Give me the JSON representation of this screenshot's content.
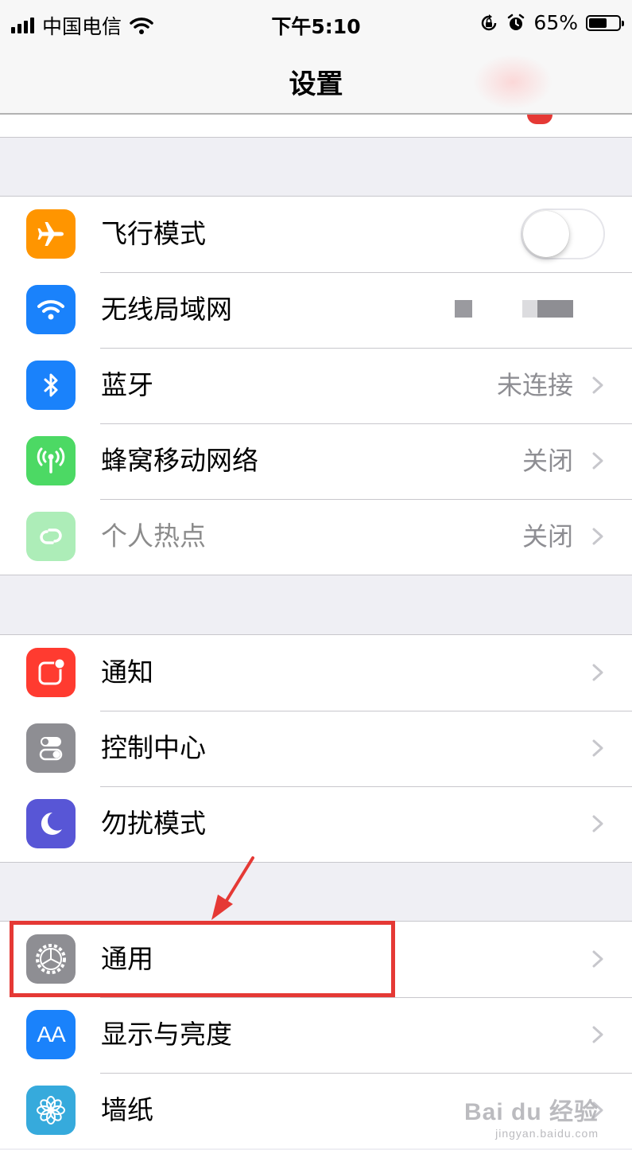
{
  "status_bar": {
    "carrier": "中国电信",
    "time": "下午5:10",
    "battery_percent": "65%",
    "battery_level": 0.65
  },
  "nav": {
    "title": "设置"
  },
  "group1": [
    {
      "label": "飞行模式",
      "icon": "airplane-icon",
      "color": "#ff9500",
      "control": "toggle",
      "toggle_on": false
    },
    {
      "label": "无线局域网",
      "icon": "wifi-icon",
      "color": "#1a82fb",
      "control": "obscured"
    },
    {
      "label": "蓝牙",
      "icon": "bluetooth-icon",
      "color": "#1a82fb",
      "value": "未连接"
    },
    {
      "label": "蜂窝移动网络",
      "icon": "cellular-icon",
      "color": "#4cd964",
      "value": "关闭"
    },
    {
      "label": "个人热点",
      "icon": "hotspot-icon",
      "color": "#4cd964",
      "value": "关闭",
      "disabled": true
    }
  ],
  "group2": [
    {
      "label": "通知",
      "icon": "notifications-icon",
      "color": "#ff3b30"
    },
    {
      "label": "控制中心",
      "icon": "control-center-icon",
      "color": "#8e8e93"
    },
    {
      "label": "勿扰模式",
      "icon": "moon-icon",
      "color": "#5856d6"
    }
  ],
  "group3": [
    {
      "label": "通用",
      "icon": "gear-icon",
      "color": "#8e8e93",
      "highlighted": true
    },
    {
      "label": "显示与亮度",
      "icon": "text-size-icon",
      "color": "#1a82fb",
      "icon_text": "AA"
    },
    {
      "label": "墙纸",
      "icon": "flower-icon",
      "color": "#36aadc"
    }
  ],
  "watermark": {
    "main": "Bai du 经验",
    "sub": "jingyan.baidu.com"
  },
  "colors": {
    "annotation": "#e53935",
    "separator": "#c8c7cc",
    "background": "#efeff4"
  }
}
